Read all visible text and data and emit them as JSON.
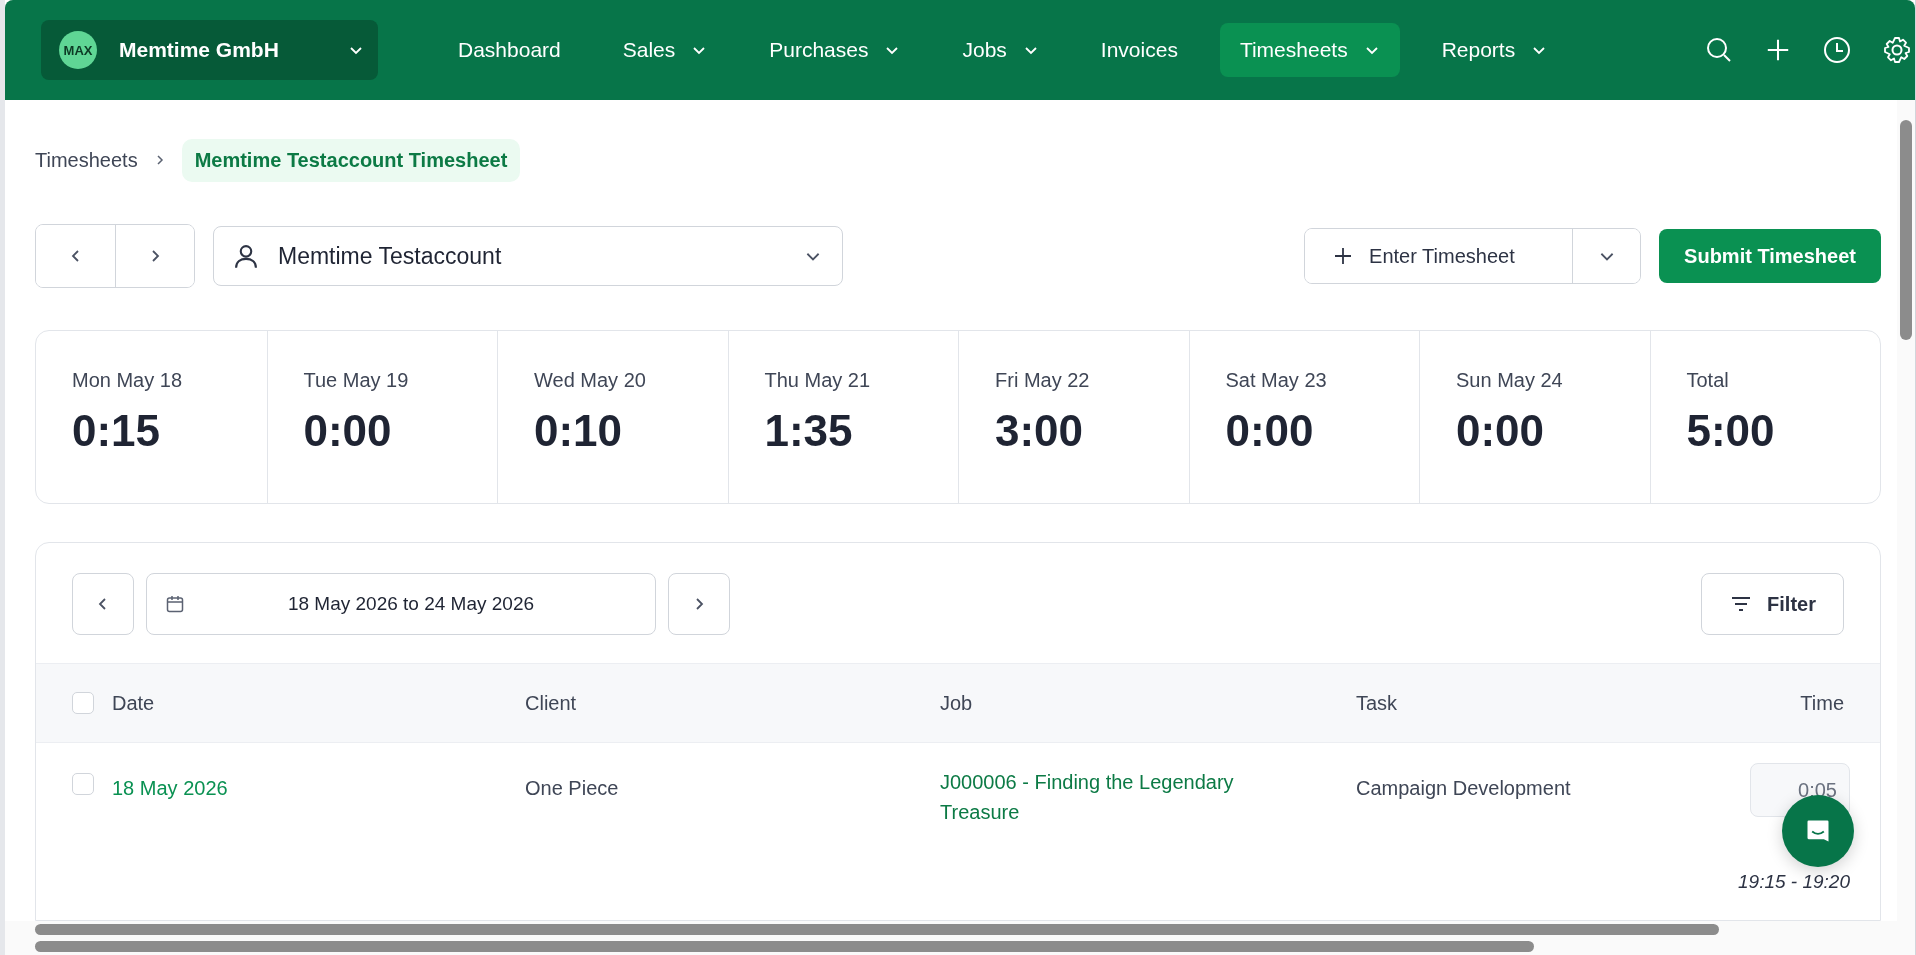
{
  "company": {
    "logo": "MAX",
    "name": "Memtime GmbH"
  },
  "nav": [
    {
      "label": "Dashboard",
      "has_menu": false,
      "selected": false
    },
    {
      "label": "Sales",
      "has_menu": true,
      "selected": false
    },
    {
      "label": "Purchases",
      "has_menu": true,
      "selected": false
    },
    {
      "label": "Jobs",
      "has_menu": true,
      "selected": false
    },
    {
      "label": "Invoices",
      "has_menu": false,
      "selected": false
    },
    {
      "label": "Timesheets",
      "has_menu": true,
      "selected": true
    },
    {
      "label": "Reports",
      "has_menu": true,
      "selected": false
    }
  ],
  "breadcrumb": [
    {
      "label": "Timesheets",
      "current": false
    },
    {
      "label": "Memtime Testaccount Timesheet",
      "current": true
    }
  ],
  "employee_select": {
    "value": "Memtime Testaccount"
  },
  "actions": {
    "enter": "Enter Timesheet",
    "submit": "Submit Timesheet"
  },
  "days": [
    {
      "label": "Mon May 18",
      "value": "0:15"
    },
    {
      "label": "Tue May 19",
      "value": "0:00"
    },
    {
      "label": "Wed May 20",
      "value": "0:10"
    },
    {
      "label": "Thu May 21",
      "value": "1:35"
    },
    {
      "label": "Fri May 22",
      "value": "3:00"
    },
    {
      "label": "Sat May 23",
      "value": "0:00"
    },
    {
      "label": "Sun May 24",
      "value": "0:00"
    },
    {
      "label": "Total",
      "value": "5:00"
    }
  ],
  "date_range": "18 May 2026 to 24 May 2026",
  "filter": "Filter",
  "table": {
    "select_all": {
      "checked": false
    },
    "columns": [
      "Date",
      "Client",
      "Job",
      "Task",
      "Time"
    ],
    "rows": [
      {
        "checked": false,
        "date": "18 May 2026",
        "client": "One Piece",
        "job": "J000006 - Finding the Legendary Treasure",
        "task": "Campaign Development",
        "time": "0:05",
        "time_range": "19:15 - 19:20"
      }
    ]
  }
}
